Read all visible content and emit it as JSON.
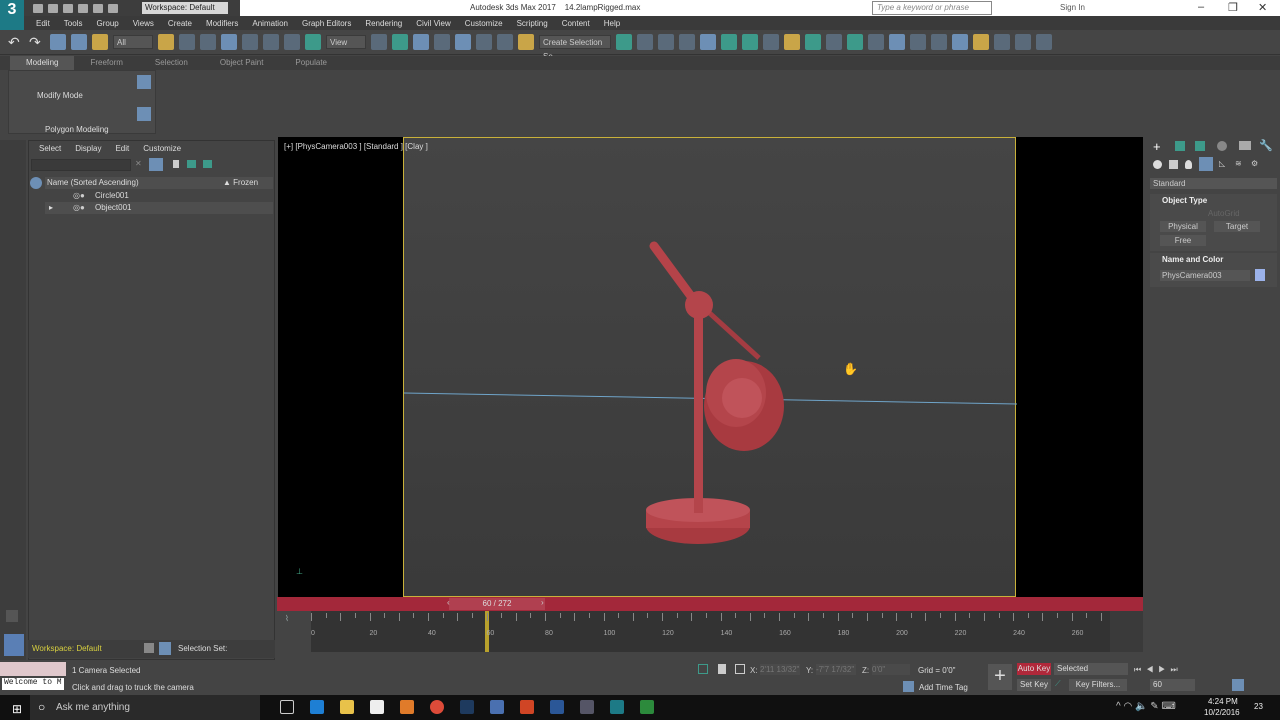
{
  "titlebar": {
    "workspace": "Workspace: Default",
    "app": "Autodesk 3ds Max 2017",
    "file": "14.2lampRigged.max",
    "search_placeholder": "Type a keyword or phrase",
    "signin": "Sign In",
    "logo": "3 MAX"
  },
  "menu": [
    "Edit",
    "Tools",
    "Group",
    "Views",
    "Create",
    "Modifiers",
    "Animation",
    "Graph Editors",
    "Rendering",
    "Civil View",
    "Customize",
    "Scripting",
    "Content",
    "Help"
  ],
  "toolbar": {
    "filter": "All",
    "refcoord": "View",
    "selset": "Create Selection Se"
  },
  "ribbon": {
    "tabs": [
      "Modeling",
      "Freeform",
      "Selection",
      "Object Paint",
      "Populate"
    ],
    "mode": "Modify Mode",
    "panel": "Polygon Modeling"
  },
  "scene": {
    "menu": [
      "Select",
      "Display",
      "Edit",
      "Customize"
    ],
    "col_name": "Name (Sorted Ascending)",
    "col_frozen": "Frozen",
    "items": [
      "Circle001",
      "Object001"
    ]
  },
  "viewport": {
    "label": "[+] [PhysCamera003 ] [Standard ] [Clay ]"
  },
  "command": {
    "category": "Standard",
    "rollout1": "Object Type",
    "autogrid": "AutoGrid",
    "buttons": [
      "Physical",
      "Target",
      "Free"
    ],
    "rollout2": "Name and Color",
    "name": "PhysCamera003",
    "color": "#9bb2ea"
  },
  "time": {
    "slider": "60 / 272",
    "current": 60,
    "total": 272,
    "ticks": [
      "0",
      "20",
      "40",
      "60",
      "80",
      "100",
      "120",
      "140",
      "160",
      "180",
      "200",
      "220",
      "240",
      "260"
    ]
  },
  "bottom": {
    "workspace": "Workspace: Default",
    "selset": "Selection Set:",
    "status1": "1 Camera Selected",
    "status2": "Click and drag to truck the camera",
    "welcome": "Welcome to M",
    "x_label": "X:",
    "x": "2'11 13/32\"",
    "y_label": "Y:",
    "y": "-7'7 17/32\"",
    "z_label": "Z:",
    "z": "0'0\"",
    "grid": "Grid = 0'0\"",
    "addtimetag": "Add Time Tag",
    "autokey": "Auto Key",
    "setkey": "Set Key",
    "keymode": "Selected",
    "keyfilters": "Key Filters...",
    "frame": "60"
  },
  "taskbar": {
    "cortana": "Ask me anything",
    "time": "4:24 PM",
    "date": "10/2/2016",
    "notif": "23"
  }
}
